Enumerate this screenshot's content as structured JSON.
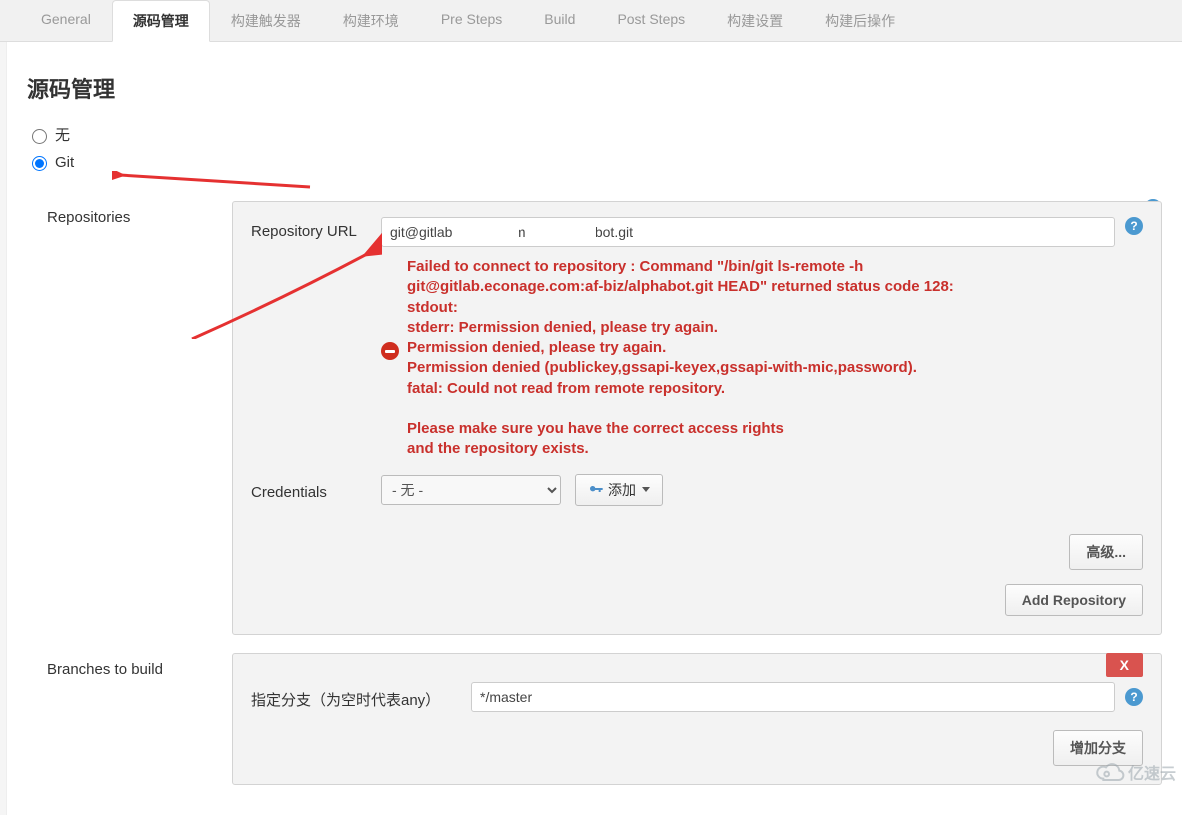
{
  "tabs": {
    "general": "General",
    "scm": "源码管理",
    "triggers": "构建触发器",
    "env": "构建环境",
    "presteps": "Pre Steps",
    "build": "Build",
    "poststeps": "Post Steps",
    "settings": "构建设置",
    "postactions": "构建后操作"
  },
  "section": {
    "title": "源码管理"
  },
  "scm_options": {
    "none": "无",
    "git": "Git"
  },
  "repositories": {
    "label": "Repositories",
    "url_label": "Repository URL",
    "url_value": "git@gitlab           .com        /alphabot.git",
    "credentials_label": "Credentials",
    "credentials_value": "- 无 -",
    "add_label": "添加",
    "advanced_btn": "高级...",
    "add_repo_btn": "Add Repository",
    "error": " Failed to connect to repository : Command \"/bin/git ls-remote -h\ngit@gitlab.econage.com:af-biz/alphabot.git HEAD\" returned status code 128:\nstdout:\nstderr: Permission denied, please try again.\nPermission denied, please try again.\nPermission denied (publickey,gssapi-keyex,gssapi-with-mic,password).\nfatal: Could not read from remote repository.\n\nPlease make sure you have the correct access rights\nand the repository exists."
  },
  "branches": {
    "label": "Branches to build",
    "spec_label": "指定分支（为空时代表any）",
    "spec_value": "*/master",
    "del": "X",
    "add_branch_btn": "增加分支"
  },
  "watermark": "亿速云"
}
